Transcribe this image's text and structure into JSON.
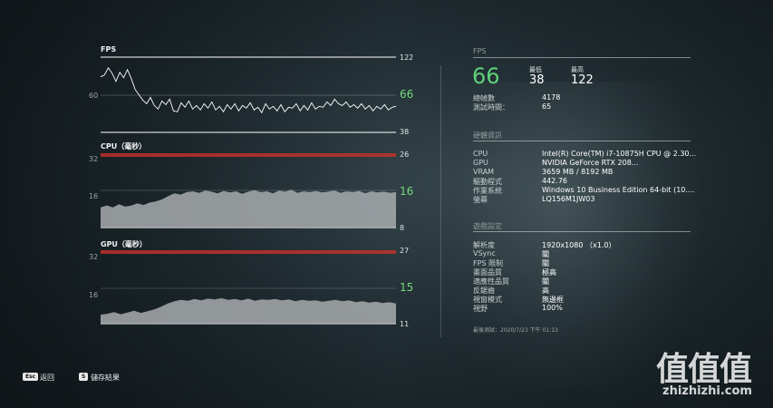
{
  "graphs": {
    "fps": {
      "title": "FPS",
      "left_tick": "60",
      "max_label": "122",
      "min_label": "38",
      "current": "66",
      "current_color": "#78d87c",
      "line_color": "#ffffff"
    },
    "cpu": {
      "title": "CPU（毫秒）",
      "left_tick_top": "32",
      "left_tick_mid": "16",
      "max_label": "26",
      "min_label": "8",
      "current": "16",
      "current_color": "#78d87c",
      "band_color": "#c0312b"
    },
    "gpu": {
      "title": "GPU（毫秒）",
      "left_tick_top": "32",
      "left_tick_mid": "16",
      "max_label": "27",
      "min_label": "11",
      "current": "15",
      "current_color": "#78d87c",
      "band_color": "#c0312b"
    }
  },
  "chart_data": [
    {
      "type": "line",
      "title": "FPS",
      "series": [
        {
          "values": [
            100,
            102,
            110,
            104,
            95,
            105,
            99,
            108,
            98,
            86,
            80,
            74,
            70,
            77,
            68,
            64,
            73,
            69,
            75,
            62,
            61,
            71,
            66,
            73,
            64,
            68,
            63,
            70,
            65,
            72,
            63,
            67,
            61,
            69,
            64,
            70,
            62,
            68,
            65,
            71,
            63,
            66,
            60,
            70,
            64,
            67,
            62,
            69,
            61,
            66,
            65,
            70,
            62,
            68,
            63,
            71,
            64,
            67,
            66,
            72,
            68,
            75,
            70,
            68,
            72,
            66,
            69,
            65,
            70,
            64,
            68,
            62,
            67,
            64,
            69,
            63,
            66,
            67
          ]
        }
      ],
      "ylim": [
        38,
        122
      ],
      "current": 66
    },
    {
      "type": "area",
      "title": "CPU（毫秒）",
      "series": [
        {
          "values": [
            13,
            13.5,
            13,
            13.8,
            13.2,
            13.5,
            14,
            13.6,
            14.2,
            14.5,
            15,
            15.8,
            16.5,
            16.2,
            16.8,
            17,
            16.6,
            17.2,
            16.9,
            16.5,
            17.1,
            16.7,
            17,
            16.4,
            16.9,
            17.3,
            16.8,
            17,
            16.5,
            17.2,
            16.9,
            17.4,
            16.6,
            17,
            16.8,
            17.1,
            16.7,
            16.9,
            17.2,
            16.6,
            17,
            16.8,
            17.1,
            16.5,
            17,
            16.7,
            16.9,
            16.6,
            16.8
          ]
        }
      ],
      "ylim": [
        8,
        26
      ],
      "current": 16
    },
    {
      "type": "area",
      "title": "GPU（毫秒）",
      "series": [
        {
          "values": [
            13,
            13.2,
            13.6,
            13.1,
            13.5,
            13.9,
            13.4,
            13.8,
            14.2,
            14.8,
            15.5,
            16,
            16.3,
            16.1,
            16.5,
            16.2,
            16.6,
            16.4,
            16.7,
            16.3,
            16.5,
            16.2,
            16.6,
            16.1,
            16.4,
            16.3,
            16.5,
            16.2,
            16.4,
            16,
            16.3,
            16.1,
            16.2,
            15.9,
            16.1,
            16.3,
            16,
            16.2,
            15.8,
            16,
            15.7,
            15.9,
            15.6,
            15.8,
            15.5
          ]
        }
      ],
      "ylim": [
        11,
        27
      ],
      "current": 15
    }
  ],
  "panel": {
    "fps_heading": "FPS",
    "fps_current": "66",
    "fps_current_color": "#5fd178",
    "min_label": "最低",
    "min_value": "38",
    "max_label": "最高",
    "max_value": "122",
    "stats": [
      {
        "key": "總幀數",
        "value": "4178"
      },
      {
        "key": "測試時間：",
        "value": "65"
      }
    ],
    "hardware_heading": "硬體資訊",
    "hardware": [
      {
        "key": "CPU",
        "value": "Intel(R) Core(TM) i7-10875H CPU @ 2.30..."
      },
      {
        "key": "GPU",
        "value": "NVIDIA GeForce RTX 208..."
      },
      {
        "key": "VRAM",
        "value": "3659 MB / 8192 MB"
      },
      {
        "key": "驅動程式",
        "value": "442.76"
      },
      {
        "key": "作業系統",
        "value": "Windows 10 Business Edition 64-bit (10...."
      },
      {
        "key": "螢幕",
        "value": "LQ156M1JW03"
      }
    ],
    "settings_heading": "遊戲設定",
    "settings": [
      {
        "key": "解析度",
        "value": "1920x1080 （x1.0）"
      },
      {
        "key": "VSync",
        "value": "關"
      },
      {
        "key": "FPS 限制",
        "value": "關"
      },
      {
        "key": "畫面品質",
        "value": "極高"
      },
      {
        "key": "適應性品質",
        "value": "關"
      },
      {
        "key": "反鋸齒",
        "value": "高"
      },
      {
        "key": "視窗模式",
        "value": "無邊框"
      },
      {
        "key": "視野",
        "value": "100%"
      }
    ],
    "last_test": "最後測試：2020/7/23 下午 01:13"
  },
  "footer": {
    "back_key": "Esc",
    "back_label": "返回",
    "save_key": "S",
    "save_label": "儲存結果"
  },
  "watermark": {
    "logo": "值值值",
    "site": "zhizhizhi.com"
  }
}
